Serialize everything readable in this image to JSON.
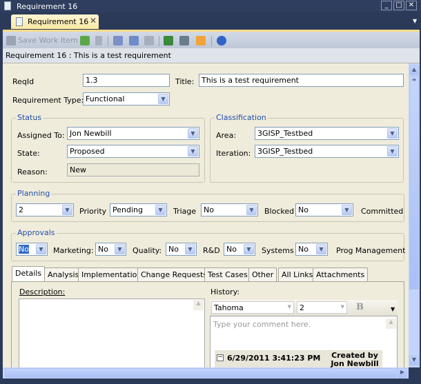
{
  "window": {
    "title": "Requirement 16",
    "doc_tab": "Requirement 16"
  },
  "toolbar": {
    "save_label": "Save Work Item"
  },
  "header": {
    "text": "Requirement 16 : This is a test requirement"
  },
  "fields": {
    "reqid_label": "ReqId",
    "reqid": "1.3",
    "title_label": "Title:",
    "title": "This is a test requirement",
    "reqtype_label": "Requirement Type:",
    "reqtype": "Functional"
  },
  "status": {
    "title": "Status",
    "assigned_label": "Assigned To:",
    "assigned": "Jon Newbill",
    "state_label": "State:",
    "state": "Proposed",
    "reason_label": "Reason:",
    "reason": "New"
  },
  "classification": {
    "title": "Classification",
    "area_label": "Area:",
    "area": "3GISP_Testbed",
    "iteration_label": "Iteration:",
    "iteration": "3GISP_Testbed"
  },
  "planning": {
    "title": "Planning",
    "first": "2",
    "priority_label": "Priority",
    "priority": "Pending",
    "triage_label": "Triage",
    "triage": "No",
    "blocked_label": "Blocked",
    "blocked": "No",
    "committed_label": "Committed"
  },
  "approvals": {
    "title": "Approvals",
    "first": "No",
    "marketing_label": "Marketing:",
    "marketing": "No",
    "quality_label": "Quality:",
    "quality": "No",
    "rd_label": "R&D",
    "rd": "No",
    "systems_label": "Systems",
    "systems": "No",
    "prog_label": "Prog Management"
  },
  "tabs": [
    "Details",
    "Analysis",
    "Implementation",
    "Change Requests",
    "Test Cases",
    "Other",
    "All Links",
    "Attachments"
  ],
  "details": {
    "description_label": "Description:",
    "history_label": "History:",
    "font": "Tahoma",
    "size": "2",
    "bold": "B",
    "comment_placeholder": "Type your comment here.",
    "entry_date": "6/29/2011 3:41:23 PM",
    "entry_by": "Created by Jon Newbill"
  }
}
